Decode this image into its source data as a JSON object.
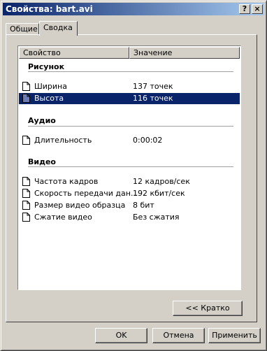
{
  "window": {
    "title": "Свойства: bart.avi",
    "help_label": "?",
    "close_label": "×"
  },
  "tabs": [
    {
      "label": "Общие"
    },
    {
      "label": "Сводка"
    }
  ],
  "list": {
    "columns": [
      "Свойство",
      "Значение"
    ],
    "groups": [
      {
        "name": "Рисунок",
        "rows": [
          {
            "name": "Ширина",
            "value": "137 точек"
          },
          {
            "name": "Высота",
            "value": "116 точек",
            "selected": true
          }
        ]
      },
      {
        "name": "Аудио",
        "rows": [
          {
            "name": "Длительность",
            "value": "0:00:02"
          }
        ]
      },
      {
        "name": "Видео",
        "rows": [
          {
            "name": "Частота кадров",
            "value": "12 кадров/сек"
          },
          {
            "name": "Скорость передачи дан...",
            "value": "192 кбит/сек"
          },
          {
            "name": "Размер видео образца",
            "value": "8 бит"
          },
          {
            "name": "Сжатие видео",
            "value": "Без сжатия"
          }
        ]
      }
    ]
  },
  "buttons": {
    "brief": "<< Кратко",
    "ok": "OK",
    "cancel": "Отмена",
    "apply": "Применить"
  },
  "colors": {
    "titlebar_start": "#0a246a",
    "titlebar_end": "#a6caf0",
    "selection": "#0a246a",
    "face": "#d4d0c8"
  }
}
